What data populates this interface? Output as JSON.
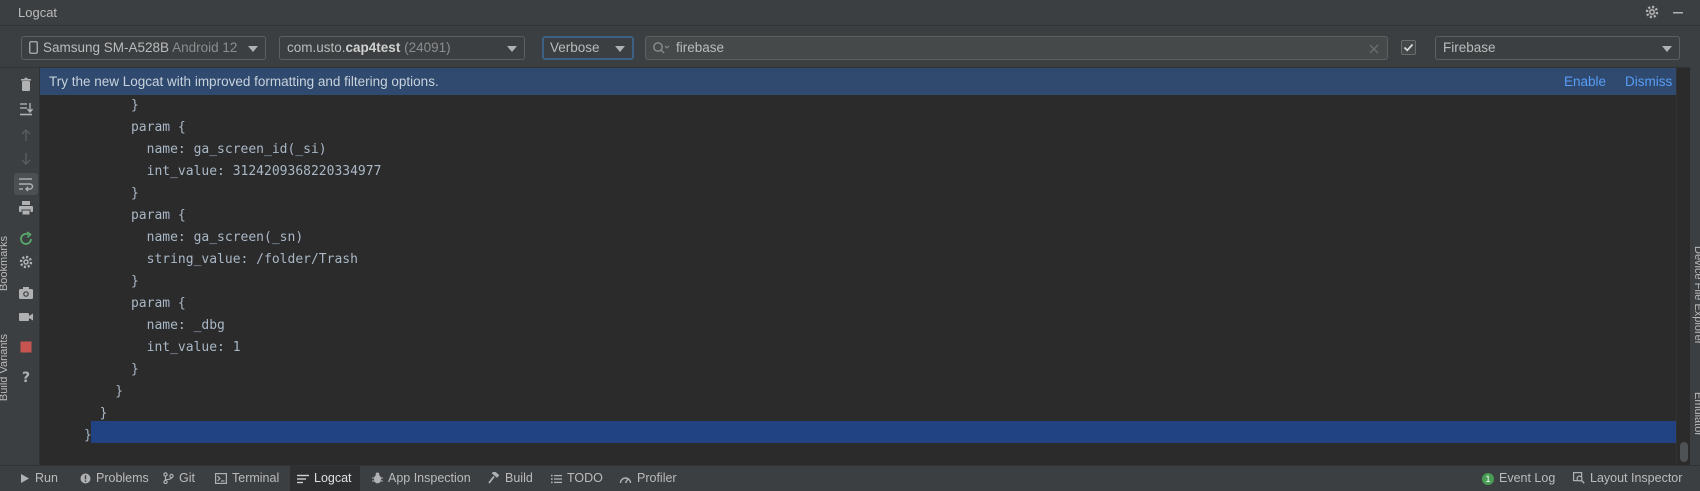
{
  "window": {
    "title": "Logcat",
    "icons": [
      "gear-icon",
      "minimize-icon"
    ]
  },
  "toolbar": {
    "device": {
      "name": "Samsung SM-A528B",
      "os": "Android 12"
    },
    "process": {
      "prefix": "com.usto.",
      "bold": "cap4test",
      "pid": "(24091)"
    },
    "log_level": "Verbose",
    "search": {
      "value": "firebase",
      "placeholder": ""
    },
    "regex_checked": true,
    "filter": "Firebase"
  },
  "left_toolbar": {
    "icons": [
      "trash-icon",
      "scroll-to-end-icon",
      "up-arrow-icon",
      "down-arrow-icon",
      "soft-wrap-icon",
      "print-icon",
      "restart-icon",
      "settings-icon",
      "screenshot-icon",
      "screen-record-icon",
      "stop-icon",
      "help-icon"
    ],
    "side_tabs": [
      "Bookmarks",
      "Build Variants"
    ]
  },
  "right_side_tabs": [
    "Device File Explorer",
    "Emulator"
  ],
  "banner": {
    "message": "Try the new Logcat with improved formatting and filtering options.",
    "enable_label": "Enable",
    "dismiss_label": "Dismiss"
  },
  "log_lines": [
    "      }",
    "      param {",
    "        name: ga_screen_id(_si)",
    "        int_value: 3124209368220334977",
    "      }",
    "      param {",
    "        name: ga_screen(_sn)",
    "        string_value: /folder/Trash",
    "      }",
    "      param {",
    "        name: _dbg",
    "        int_value: 1",
    "      }",
    "    }",
    "  }",
    "}"
  ],
  "status_bar": {
    "left": [
      {
        "label": "Run",
        "icon": "play-icon"
      },
      {
        "label": "Problems",
        "icon": "problems-icon"
      },
      {
        "label": "Git",
        "icon": "git-branch-icon"
      },
      {
        "label": "Terminal",
        "icon": "terminal-icon"
      },
      {
        "label": "Logcat",
        "icon": "logcat-icon",
        "active": true
      },
      {
        "label": "App Inspection",
        "icon": "bug-icon"
      },
      {
        "label": "Build",
        "icon": "hammer-icon"
      },
      {
        "label": "TODO",
        "icon": "list-icon"
      },
      {
        "label": "Profiler",
        "icon": "gauge-icon"
      }
    ],
    "right": [
      {
        "label": "Event Log",
        "badge": "1"
      },
      {
        "label": "Layout Inspector",
        "icon": "layout-inspector-icon"
      }
    ]
  },
  "colors": {
    "background": "#2b2b2b",
    "panel": "#3c3f41",
    "banner": "#2f4a6e",
    "link": "#589df6",
    "selection": "#214283",
    "stop": "#c75450"
  }
}
